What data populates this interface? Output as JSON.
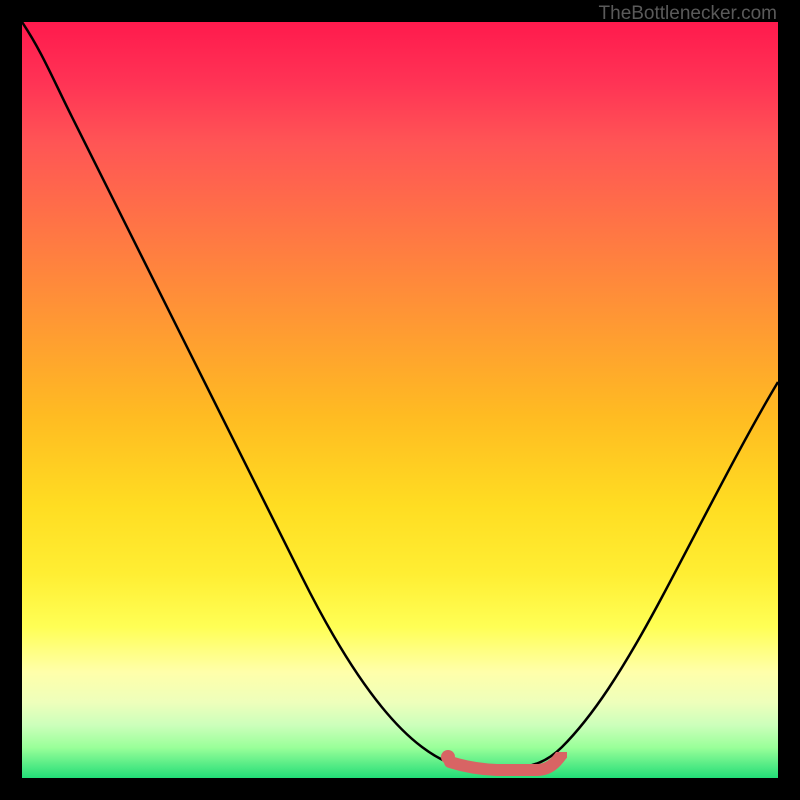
{
  "watermark": "TheBottlenecker.com",
  "chart_data": {
    "type": "line",
    "title": "",
    "xlabel": "",
    "ylabel": "",
    "xlim": [
      0,
      100
    ],
    "ylim": [
      0,
      100
    ],
    "series": [
      {
        "name": "curve",
        "x": [
          0,
          5,
          10,
          15,
          20,
          25,
          30,
          35,
          40,
          45,
          50,
          55,
          58,
          60,
          62,
          65,
          68,
          70,
          75,
          80,
          85,
          90,
          95,
          100
        ],
        "y": [
          100,
          94,
          87,
          79,
          71,
          62,
          54,
          45,
          37,
          28,
          19,
          11,
          6,
          4,
          3,
          2,
          3,
          4,
          9,
          16,
          24,
          33,
          42,
          52
        ]
      }
    ],
    "optimal_zone": {
      "x_start": 58,
      "x_end": 72,
      "y": 2
    },
    "background_gradient": {
      "top": "#ff1a4d",
      "middle": "#ffee33",
      "bottom": "#22dd77"
    }
  }
}
